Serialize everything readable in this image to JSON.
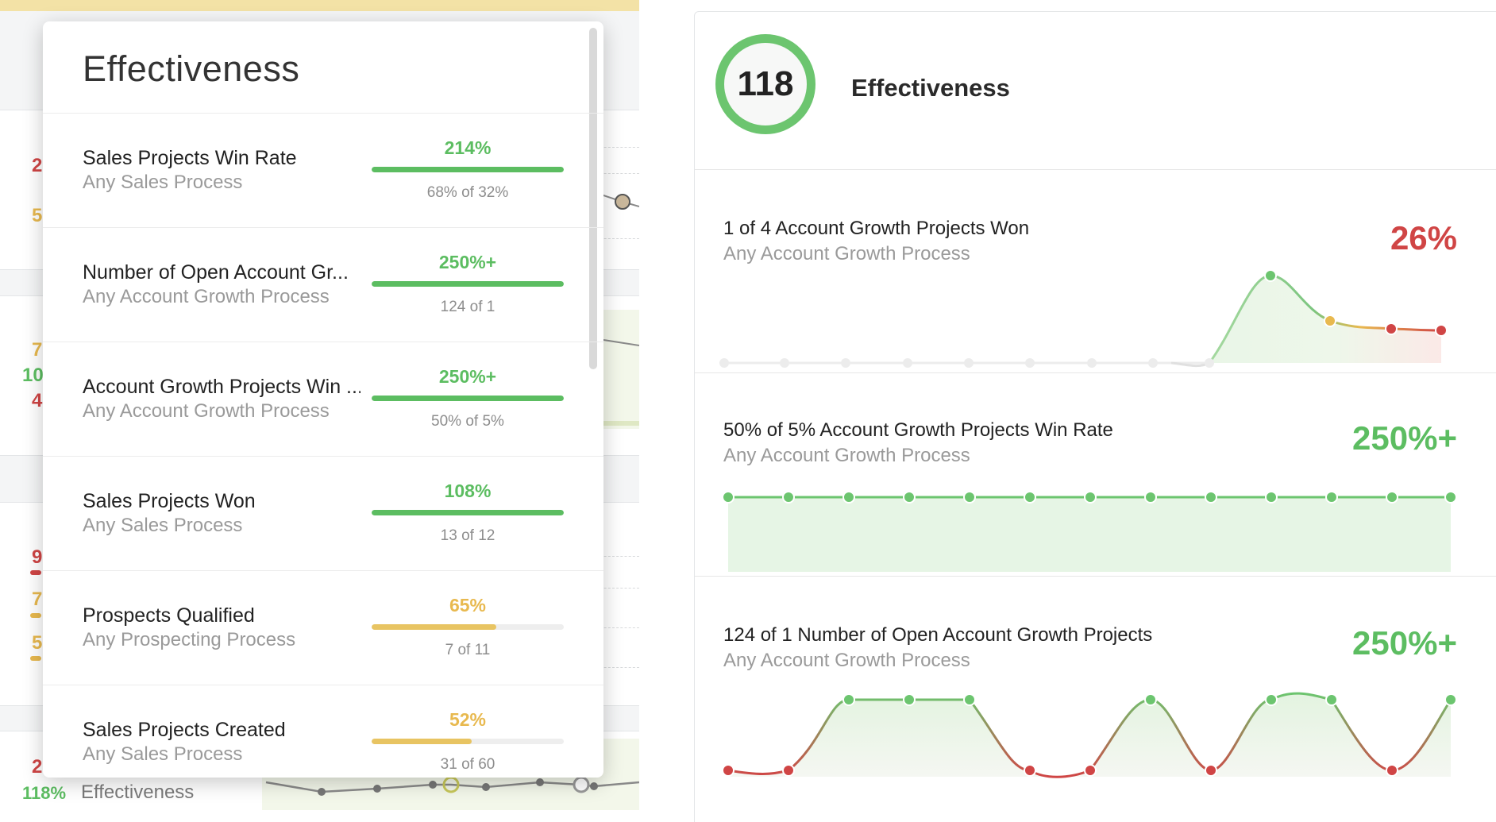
{
  "left_background": {
    "numbers": [
      {
        "text": "2",
        "tone": "red"
      },
      {
        "text": "5",
        "tone": "yellow"
      },
      {
        "text": "7",
        "tone": "yellow"
      },
      {
        "text": "10",
        "tone": "green"
      },
      {
        "text": "4",
        "tone": "red"
      },
      {
        "text": "9",
        "tone": "red"
      },
      {
        "text": "7",
        "tone": "yellow"
      },
      {
        "text": "5",
        "tone": "yellow"
      },
      {
        "text": "2",
        "tone": "red"
      }
    ],
    "footer": {
      "percent": "118%",
      "label": "Effectiveness"
    }
  },
  "popup": {
    "title": "Effectiveness",
    "rows": [
      {
        "name": "Sales Projects Win Rate",
        "process": "Any Sales Process",
        "percent": "214%",
        "detail": "68% of 32%",
        "fill": 1.0,
        "tone": "green"
      },
      {
        "name": "Number of Open Account Gr...",
        "process": "Any Account Growth Process",
        "percent": "250%+",
        "detail": "124 of 1",
        "fill": 1.0,
        "tone": "green"
      },
      {
        "name": "Account Growth Projects Win ...",
        "process": "Any Account Growth Process",
        "percent": "250%+",
        "detail": "50% of 5%",
        "fill": 1.0,
        "tone": "green"
      },
      {
        "name": "Sales Projects Won",
        "process": "Any Sales Process",
        "percent": "108%",
        "detail": "13 of 12",
        "fill": 1.0,
        "tone": "green"
      },
      {
        "name": "Prospects Qualified",
        "process": "Any Prospecting Process",
        "percent": "65%",
        "detail": "7 of 11",
        "fill": 0.65,
        "tone": "yellow"
      },
      {
        "name": "Sales Projects Created",
        "process": "Any Sales Process",
        "percent": "52%",
        "detail": "31 of 60",
        "fill": 0.52,
        "tone": "yellow"
      }
    ]
  },
  "right_card": {
    "score": "118",
    "title": "Effectiveness",
    "sections": [
      {
        "title": "1 of 4 Account Growth Projects Won",
        "process": "Any Account Growth Process",
        "big": "26%",
        "tone": "red"
      },
      {
        "title": "50% of 5% Account Growth Projects Win Rate",
        "process": "Any Account Growth Process",
        "big": "250%+",
        "tone": "green"
      },
      {
        "title": "124 of 1 Number of Open Account Growth Projects",
        "process": "Any Account Growth Process",
        "big": "250%+",
        "tone": "green"
      }
    ]
  },
  "colors": {
    "green": "#5cbd61",
    "yellow": "#e8b94f",
    "red": "#d04545",
    "ring": "#6cc56f"
  }
}
